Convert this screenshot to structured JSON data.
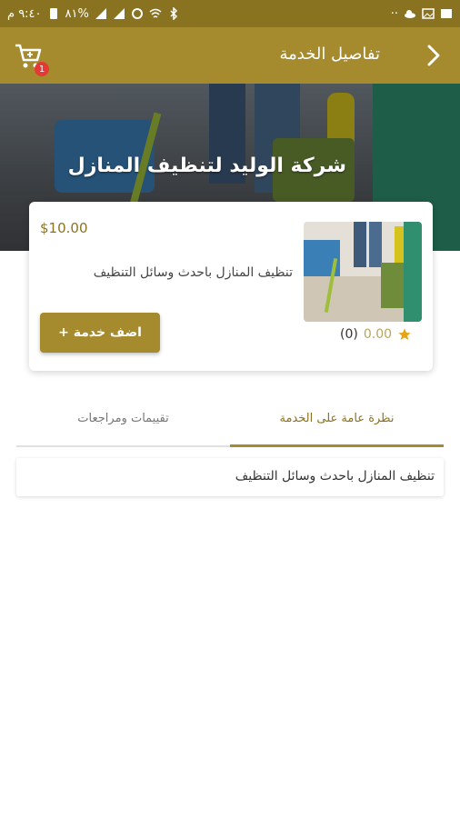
{
  "status_bar": {
    "time": "٩:٤٠ م",
    "battery": "٨١%"
  },
  "app_bar": {
    "title": "تفاصيل الخدمة",
    "cart_badge": "1"
  },
  "hero": {
    "company_name": "شركة الوليد لتنظيف المنازل"
  },
  "service_card": {
    "price": "$10.00",
    "description": "تنظيف المنازل باحدث وسائل التنظيف",
    "add_button": "اضف خدمة +",
    "rating_value": "0.00",
    "rating_count": "(0)"
  },
  "tabs": [
    {
      "label": "نظرة عامة على الخدمة",
      "active": true
    },
    {
      "label": "تقييمات ومراجعات",
      "active": false
    }
  ],
  "overview": {
    "text": "تنظيف المنازل باحدث وسائل التنظيف"
  },
  "colors": {
    "status_bar": "#8a7320",
    "brand": "#a58a2e",
    "star": "#e6a417"
  },
  "icons": {
    "back": "chevron-right-icon",
    "cart": "cart-icon",
    "star": "star-icon"
  }
}
